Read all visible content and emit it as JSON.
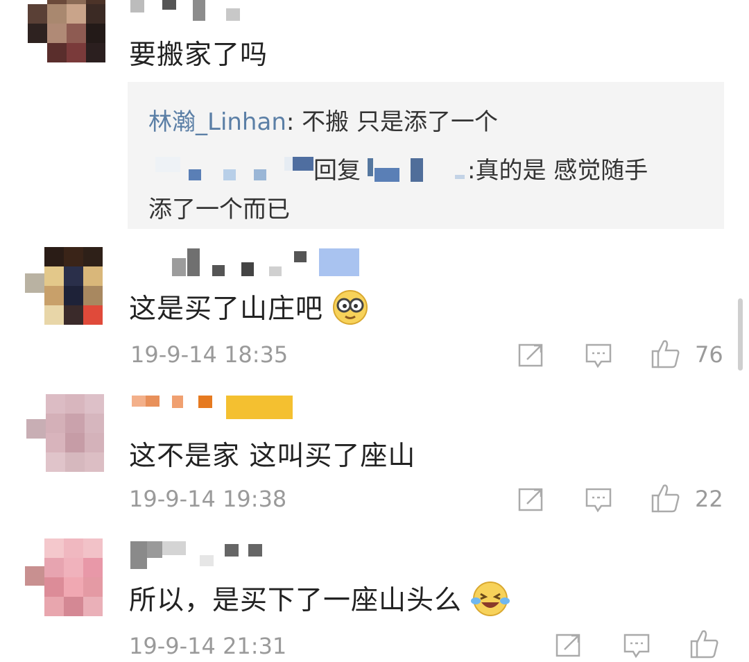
{
  "comments": [
    {
      "text": "要搬家了吗",
      "replies": [
        {
          "name": "林瀚_Linhan",
          "sep": ":",
          "text": " 不搬 只是添了一个"
        },
        {
          "prefix": "回复",
          "suffix": ":真的是 感觉随手",
          "cont": "添了一个而已"
        }
      ]
    },
    {
      "text": "这是买了山庄吧",
      "time": "19-9-14 18:35",
      "likes": "76",
      "emoji": "nerd-face-icon"
    },
    {
      "text": "这不是家 这叫买了座山",
      "time": "19-9-14 19:38",
      "likes": "22"
    },
    {
      "text": "所以，是买下了一座山头么",
      "time": "19-9-14 21:31",
      "emoji": "laughing-crying-face-icon"
    }
  ],
  "colors": {
    "link": "#5b7fa6",
    "meta": "#9a9a9a",
    "reply_bg": "#f4f4f4"
  }
}
